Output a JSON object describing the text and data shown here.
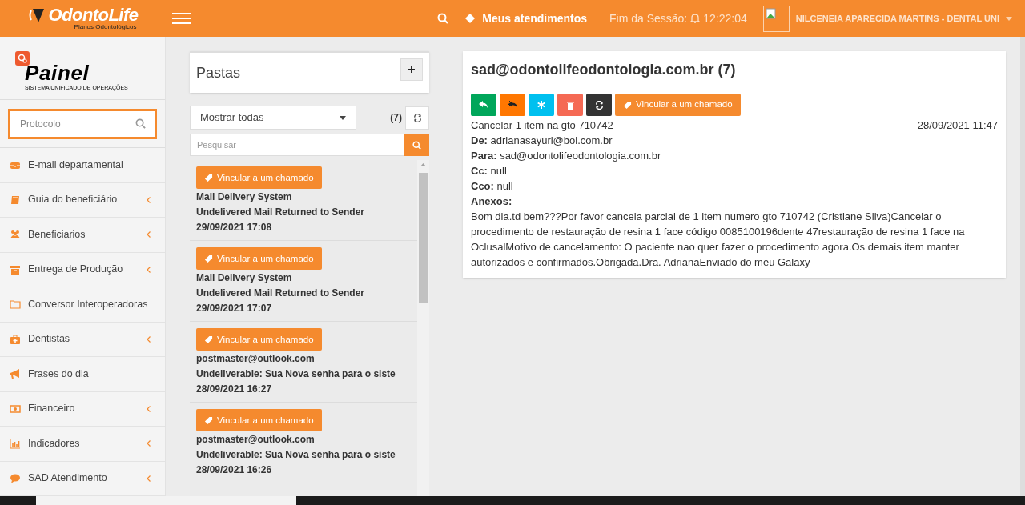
{
  "header": {
    "logo": {
      "name": "OdontoLife",
      "tagline": "Planos Odontológicos"
    },
    "my_tickets": "Meus atendimentos",
    "session_label": "Fim da Sessão:",
    "session_time": "12:22:04",
    "user": "NILCENEIA APARECIDA MARTINS - DENTAL UNI"
  },
  "sidebar": {
    "brand": {
      "name": "Painel",
      "tagline": "SISTEMA UNIFICADO DE OPERAÇÕES"
    },
    "search": {
      "placeholder": "Protocolo"
    },
    "items": [
      {
        "label": "E-mail departamental",
        "expandable": false
      },
      {
        "label": "Guia do beneficiário",
        "expandable": true
      },
      {
        "label": "Beneficiarios",
        "expandable": true
      },
      {
        "label": "Entrega de Produção",
        "expandable": true
      },
      {
        "label": "Conversor Interoperadoras",
        "expandable": false
      },
      {
        "label": "Dentistas",
        "expandable": true
      },
      {
        "label": "Frases do dia",
        "expandable": false
      },
      {
        "label": "Financeiro",
        "expandable": true
      },
      {
        "label": "Indicadores",
        "expandable": true
      },
      {
        "label": "SAD Atendimento",
        "expandable": true
      }
    ]
  },
  "folders": {
    "title": "Pastas",
    "add_button": "+",
    "filter": "Mostrar todas",
    "count": "(7)",
    "search": {
      "placeholder": "Pesquisar"
    },
    "messages": [
      {
        "button": "Vincular a um chamado",
        "sender": "Mail Delivery System",
        "subject": "Undelivered Mail Returned to Sender",
        "date": "29/09/2021 17:08"
      },
      {
        "button": "Vincular a um chamado",
        "sender": "Mail Delivery System",
        "subject": "Undelivered Mail Returned to Sender",
        "date": "29/09/2021 17:07"
      },
      {
        "button": "Vincular a um chamado",
        "sender": "postmaster@outlook.com",
        "subject": "Undeliverable: Sua Nova senha para o siste",
        "date": "28/09/2021 16:27"
      },
      {
        "button": "Vincular a um chamado",
        "sender": "postmaster@outlook.com",
        "subject": "Undeliverable: Sua Nova senha para o siste",
        "date": "28/09/2021 16:26"
      }
    ]
  },
  "mail": {
    "title": "sad@odontolifeodontologia.com.br (7)",
    "actions": [
      {
        "kind": "reply"
      },
      {
        "kind": "reply_all"
      },
      {
        "kind": "forward"
      },
      {
        "kind": "delete"
      },
      {
        "kind": "refresh"
      },
      {
        "kind": "link",
        "label": "Vincular a um chamado"
      }
    ],
    "subject": "Cancelar 1 item na gto 710742",
    "date": "28/09/2021 11:47",
    "fields": [
      {
        "label": "De:",
        "value": "adrianasayuri@bol.com.br"
      },
      {
        "label": "Para:",
        "value": "sad@odontolifeodontologia.com.br"
      },
      {
        "label": "Cc:",
        "value": "null"
      },
      {
        "label": "Cco:",
        "value": "null"
      },
      {
        "label": "Anexos:"
      }
    ],
    "body": "Bom dia.td bem???Por favor cancela parcial de 1 item numero gto 710742 (Cristiane Silva)Cancelar o procedimento  de restauração  de resina 1 face código 0085100196dente 47restauração de resina 1 face na OclusalMotivo de cancelamento: O paciente  nao quer fazer  o procedimento agora.Os demais item manter autorizados e confirmados.Obrigada.Dra. AdrianaEnviado do meu Galaxy"
  }
}
